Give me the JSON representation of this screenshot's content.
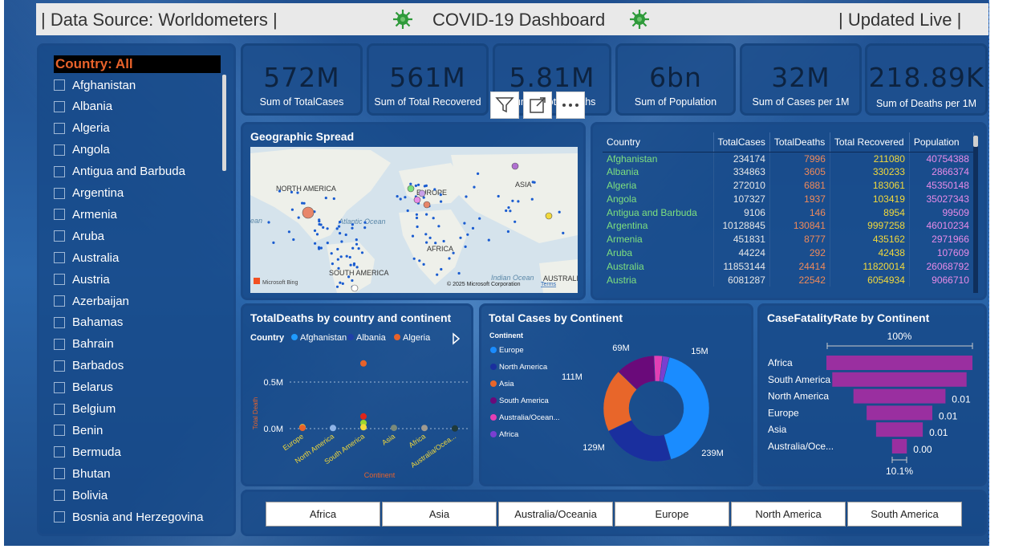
{
  "header": {
    "source": "| Data Source: Worldometers |",
    "title": "COVID-19 Dashboard",
    "updated": "| Updated Live |"
  },
  "kpis": [
    {
      "value": "572M",
      "label": "Sum of TotalCases"
    },
    {
      "value": "561M",
      "label": "Sum of Total Recovered"
    },
    {
      "value": "5.81M",
      "label": "Sum of TotalDeaths"
    },
    {
      "value": "6bn",
      "label": "Sum of Population"
    },
    {
      "value": "32M",
      "label": "Sum of Cases per 1M"
    },
    {
      "value": "218.89K",
      "label": "Sum of Deaths per 1M"
    }
  ],
  "slicer": {
    "header": "Country: All",
    "items": [
      "Afghanistan",
      "Albania",
      "Algeria",
      "Angola",
      "Antigua and Barbuda",
      "Argentina",
      "Armenia",
      "Aruba",
      "Australia",
      "Austria",
      "Azerbaijan",
      "Bahamas",
      "Bahrain",
      "Barbados",
      "Belarus",
      "Belgium",
      "Benin",
      "Bermuda",
      "Bhutan",
      "Bolivia",
      "Bosnia and Herzegovina"
    ]
  },
  "map": {
    "title": "Geographic Spread",
    "labels": {
      "na": "NORTH AMERICA",
      "eu": "EUROPE",
      "asia": "ASIA",
      "atl": "Atlantic Ocean",
      "af": "AFRICA",
      "sa": "SOUTH AMERICA",
      "ind": "Indian Ocean",
      "aus": "AUSTRALI",
      "ean": "ean"
    },
    "bing": "Microsoft Bing",
    "copyright": "© 2025 Microsoft Corporation",
    "terms": "Terms"
  },
  "table": {
    "columns": [
      "Country",
      "TotalCases",
      "TotalDeaths",
      "Total Recovered",
      "Population"
    ],
    "rows": [
      [
        "Afghanistan",
        "234174",
        "7996",
        "211080",
        "40754388"
      ],
      [
        "Albania",
        "334863",
        "3605",
        "330233",
        "2866374"
      ],
      [
        "Algeria",
        "272010",
        "6881",
        "183061",
        "45350148"
      ],
      [
        "Angola",
        "107327",
        "1937",
        "103419",
        "35027343"
      ],
      [
        "Antigua and Barbuda",
        "9106",
        "146",
        "8954",
        "99509"
      ],
      [
        "Argentina",
        "10128845",
        "130841",
        "9997258",
        "46010234"
      ],
      [
        "Armenia",
        "451831",
        "8777",
        "435162",
        "2971966"
      ],
      [
        "Aruba",
        "44224",
        "292",
        "42438",
        "107609"
      ],
      [
        "Australia",
        "11853144",
        "24414",
        "11820014",
        "26068792"
      ],
      [
        "Austria",
        "6081287",
        "22542",
        "6054934",
        "9066710"
      ]
    ]
  },
  "deaths_chart": {
    "title": "TotalDeaths by country and continent",
    "legend_title": "Country",
    "legend": [
      "Afghanistan",
      "Albania",
      "Algeria"
    ],
    "legend_colors": [
      "#1f9bff",
      "#1f3fa8",
      "#e8622a"
    ],
    "ylabel": "Total Death",
    "xlabel": "Continent",
    "yticks": [
      "0.5M",
      "0.0M"
    ]
  },
  "donut_chart": {
    "title": "Total Cases by Continent",
    "legend_title": "Continent",
    "legend": [
      "Europe",
      "North America",
      "Asia",
      "South America",
      "Australia/Ocean...",
      "Africa"
    ],
    "colors": [
      "#1a8cff",
      "#1a2f9e",
      "#e8662a",
      "#6a0a7a",
      "#e23fb4",
      "#7a3fd0"
    ]
  },
  "cfr_chart": {
    "title": "CaseFatalityRate by Continent",
    "top_label": "100%",
    "bottom_label": "10.1%",
    "value_labels": [
      "0.01",
      "0.01",
      "0.01",
      "0.00"
    ],
    "categories": [
      "Africa",
      "South America",
      "North America",
      "Europe",
      "Asia",
      "Australia/Oce..."
    ]
  },
  "chart_data": [
    {
      "type": "scatter",
      "title": "TotalDeaths by country and continent",
      "xlabel": "Continent",
      "ylabel": "Total Death",
      "categories": [
        "Europe",
        "North America",
        "South America",
        "Asia",
        "Africa",
        "Australia/Ocea..."
      ],
      "ylim": [
        0,
        1000000
      ],
      "series": [
        {
          "name": "Afghanistan",
          "values": [
            null,
            null,
            null,
            7996,
            null,
            null
          ]
        },
        {
          "name": "Albania",
          "values": [
            3605,
            null,
            null,
            null,
            null,
            null
          ]
        },
        {
          "name": "Algeria",
          "values": [
            null,
            null,
            null,
            null,
            6881,
            null
          ]
        }
      ],
      "points": [
        {
          "x": "Europe",
          "y": 15000,
          "color": "#f2d93b"
        },
        {
          "x": "Europe",
          "y": 8000,
          "color": "#e8622a"
        },
        {
          "x": "North America",
          "y": 6000,
          "color": "#8fb4e8"
        },
        {
          "x": "South America",
          "y": 700000,
          "color": "#e8622a"
        },
        {
          "x": "South America",
          "y": 130841,
          "color": "#e0251a"
        },
        {
          "x": "South America",
          "y": 60000,
          "color": "#9ad630"
        },
        {
          "x": "South America",
          "y": 15000,
          "color": "#f2d93b"
        },
        {
          "x": "Asia",
          "y": 7996,
          "color": "#7a8a7a"
        },
        {
          "x": "Africa",
          "y": 6881,
          "color": "#a09a90"
        },
        {
          "x": "Australia/Ocea...",
          "y": 2000,
          "color": "#1f3a3a"
        }
      ],
      "grid": true,
      "legend": "top-left"
    },
    {
      "type": "pie",
      "title": "Total Cases by Continent",
      "categories": [
        "Europe",
        "North America",
        "Asia",
        "South America",
        "Australia/Ocean...",
        "Africa"
      ],
      "values": [
        239,
        129,
        111,
        69,
        15,
        12
      ],
      "value_labels": [
        "239M",
        "129M",
        "111M",
        "69M",
        "15M",
        ""
      ],
      "legend": "left"
    },
    {
      "type": "bar",
      "title": "CaseFatalityRate by Continent",
      "categories": [
        "Africa",
        "South America",
        "North America",
        "Europe",
        "Asia",
        "Australia/Oce..."
      ],
      "values": [
        100,
        92,
        63,
        45,
        32,
        10.1
      ],
      "value_labels": [
        "",
        "",
        "0.01",
        "0.01",
        "0.01",
        "0.00"
      ]
    }
  ],
  "continent_buttons": [
    "Africa",
    "Asia",
    "Australia/Oceania",
    "Europe",
    "North America",
    "South America"
  ]
}
